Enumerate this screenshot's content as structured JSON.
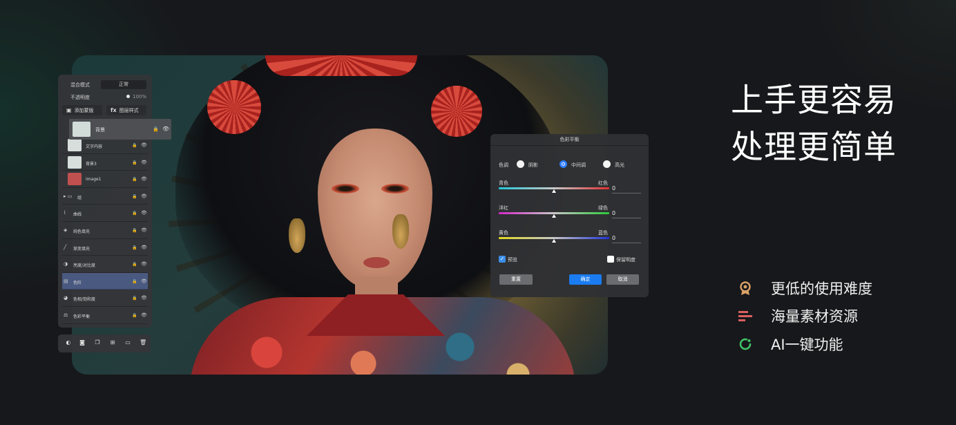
{
  "headline": {
    "line1": "上手更容易",
    "line2": "处理更简单"
  },
  "features": [
    {
      "icon": "badge-icon",
      "label": "更低的使用难度",
      "color": "#d9a267"
    },
    {
      "icon": "lines-icon",
      "label": "海量素材资源",
      "color": "#d9605e"
    },
    {
      "icon": "refresh-icon",
      "label": "AI一键功能",
      "color": "#3fc265"
    }
  ],
  "layers_panel": {
    "blend_mode_label": "混合模式",
    "blend_mode_value": "正常",
    "opacity_label": "不透明度",
    "opacity_value": "100%",
    "add_mask_label": "添加蒙版",
    "layer_style_label": "图层样式",
    "layer_style_icon_text": "fx",
    "background_layer": "背景",
    "layers": [
      {
        "name": "文字内容",
        "thumb": "#d7dedc",
        "icon": ""
      },
      {
        "name": "背景3",
        "thumb": "#d7dedc",
        "icon": ""
      },
      {
        "name": "image1",
        "thumb": "#c05050",
        "icon": ""
      },
      {
        "name": "组",
        "thumb": "",
        "icon": "folder-icon"
      },
      {
        "name": "曲线",
        "thumb": "",
        "icon": "curves-icon"
      },
      {
        "name": "纯色填充",
        "thumb": "",
        "icon": "fill-icon"
      },
      {
        "name": "渐变填充",
        "thumb": "",
        "icon": "gradient-icon"
      },
      {
        "name": "亮度/对比度",
        "thumb": "",
        "icon": "contrast-icon"
      },
      {
        "name": "色阶",
        "thumb": "",
        "icon": "levels-icon",
        "active": true
      },
      {
        "name": "色相/饱和度",
        "thumb": "",
        "icon": "hue-icon"
      },
      {
        "name": "色彩平衡",
        "thumb": "",
        "icon": "balance-icon"
      }
    ],
    "toolbar_icons": [
      "adjust-icon",
      "mask-icon",
      "duplicate-icon",
      "add-layer-icon",
      "folder-icon",
      "delete-icon"
    ]
  },
  "color_balance": {
    "title": "色彩平衡",
    "tone_label": "色调",
    "tones": [
      "阴影",
      "中间调",
      "高光"
    ],
    "selected_tone": "中间调",
    "sliders": [
      {
        "left": "青色",
        "right": "红色",
        "value": "0",
        "level": 0.5
      },
      {
        "left": "洋红",
        "right": "绿色",
        "value": "0",
        "level": 0.5
      },
      {
        "left": "黄色",
        "right": "蓝色",
        "value": "0",
        "level": 0.5
      }
    ],
    "preview_label": "预览",
    "preview_checked": true,
    "preserve_luminosity_label": "保留明度",
    "preserve_luminosity_checked": false,
    "reset_label": "重置",
    "ok_label": "确定",
    "cancel_label": "取消"
  }
}
